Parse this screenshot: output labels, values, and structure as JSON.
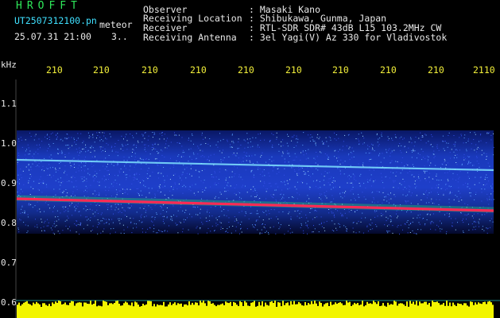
{
  "header": {
    "logo": "HROFFT",
    "filename": "UT2507312100.pn",
    "mode": "meteor",
    "datetime": "25.07.31 21:00",
    "counter": "3..",
    "fields": [
      {
        "label": "Observer",
        "value": ": Masaki Kano"
      },
      {
        "label": "Receiving Location",
        "value": ": Shibukawa, Gunma, Japan"
      },
      {
        "label": "Receiver",
        "value": ": RTL-SDR SDR# 43dB L15 103.2MHz CW"
      },
      {
        "label": "Receiving Antenna",
        "value": ": 3el Yagi(V) Az 330 for Vladivostok"
      }
    ]
  },
  "time_axis": {
    "labels": [
      "210",
      "210",
      "210",
      "210",
      "210",
      "210",
      "210",
      "210",
      "210",
      "2110"
    ]
  },
  "freq_axis": {
    "unit": "kHz",
    "ticks": [
      "1.1",
      "1.0",
      "0.9",
      "0.8",
      "0.7",
      "0.6"
    ]
  },
  "colors": {
    "background": "#000000",
    "band": "#1a3cc8",
    "noise_dot": "#5aa0ff",
    "carrier_main": "#ff2a55",
    "carrier_secondary": "#7fe3ff",
    "power_bar": "#f2f500"
  }
}
